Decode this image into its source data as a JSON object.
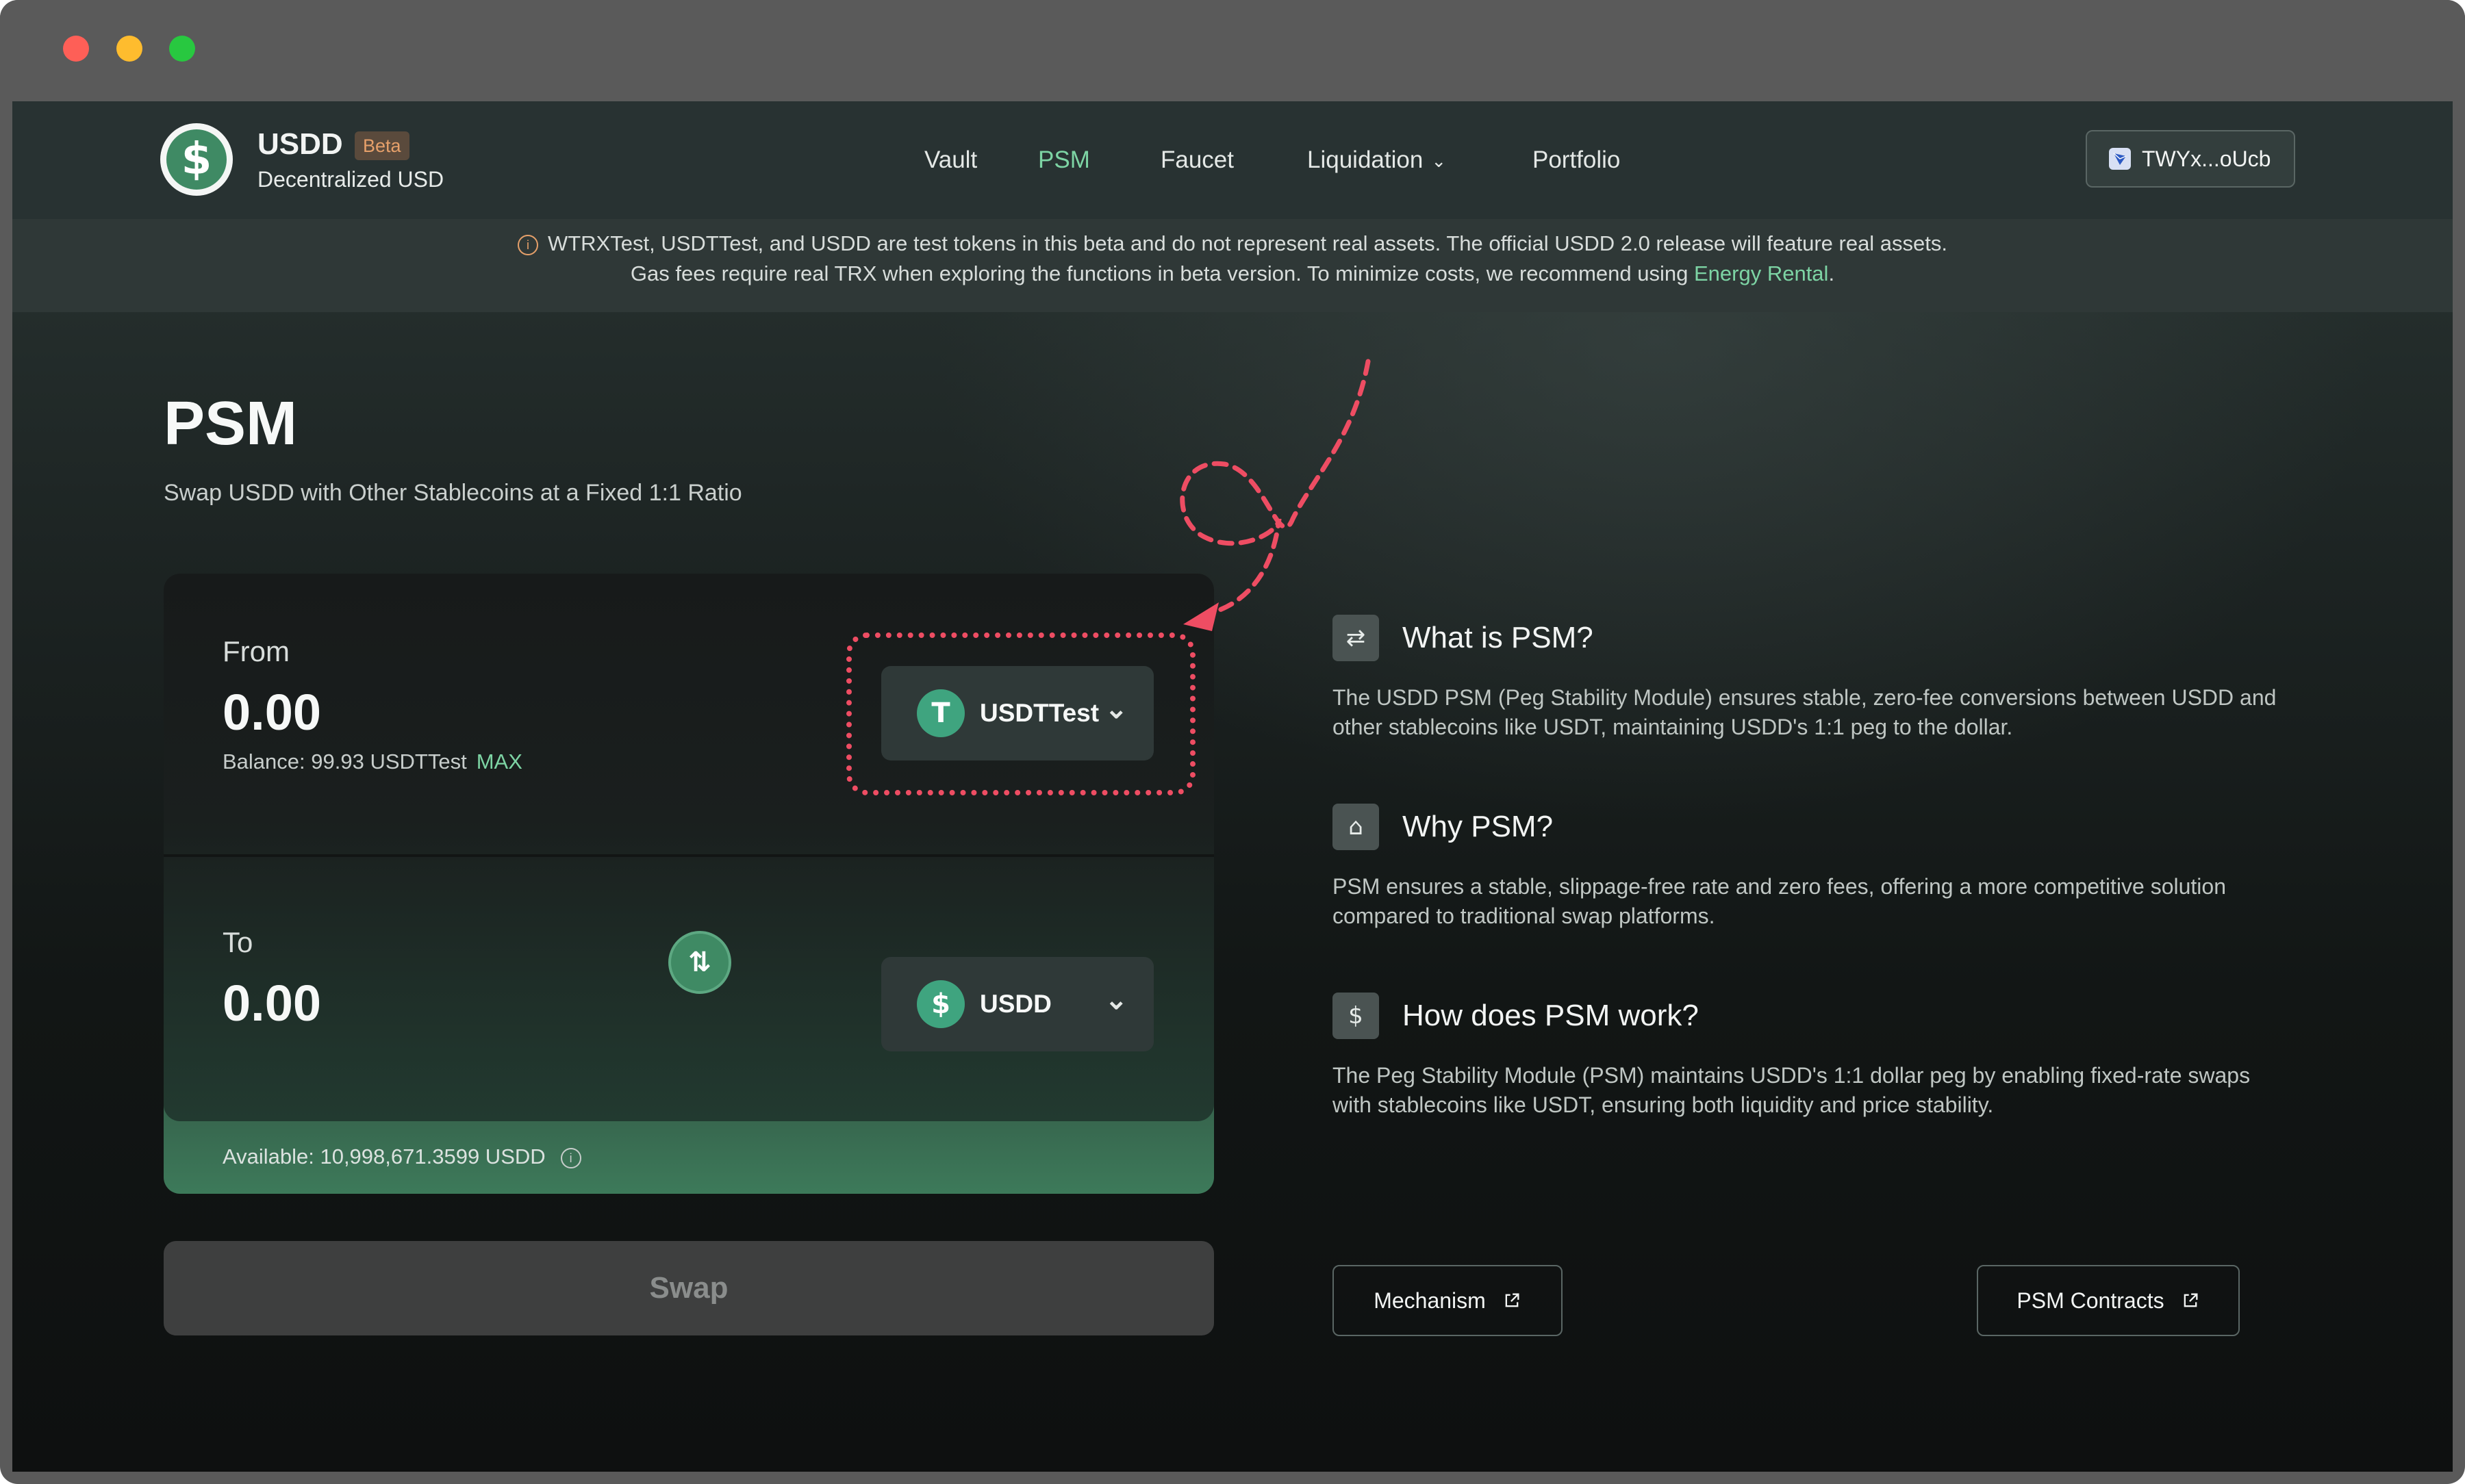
{
  "window": {
    "controls": [
      "close",
      "minimize",
      "zoom"
    ]
  },
  "brand": {
    "name": "USDD",
    "badge": "Beta",
    "tagline": "Decentralized USD",
    "logo_glyph": "$"
  },
  "nav": {
    "items": [
      {
        "label": "Vault",
        "active": false
      },
      {
        "label": "PSM",
        "active": true
      },
      {
        "label": "Faucet",
        "active": false
      },
      {
        "label": "Liquidation",
        "active": false,
        "has_dropdown": true
      },
      {
        "label": "Portfolio",
        "active": false
      }
    ],
    "wallet": {
      "address": "TWYx...oUcb",
      "icon": "wallet-icon"
    }
  },
  "banner": {
    "line1": "WTRXTest, USDTTest, and USDD are test tokens in this beta and do not represent real assets. The official USDD 2.0 release will feature real assets.",
    "line2_prefix": "Gas fees require real TRX when exploring the functions in beta version. To minimize costs, we recommend using",
    "line2_link": "Energy Rental",
    "line2_suffix": "."
  },
  "page": {
    "title": "PSM",
    "subtitle": "Swap USDD with Other Stablecoins at a Fixed 1:1 Ratio"
  },
  "swap": {
    "from": {
      "label": "From",
      "amount": "0.00",
      "balance": "Balance: 99.93 USDTTest",
      "max": "MAX",
      "token": "USDTTest",
      "token_glyph": "T"
    },
    "to": {
      "label": "To",
      "amount": "0.00",
      "token": "USDD",
      "token_glyph": "$"
    },
    "available": "Available:  10,998,671.3599 USDD",
    "button": "Swap"
  },
  "info": [
    {
      "title": "What is PSM?",
      "icon": "exchange-icon",
      "text": "The USDD PSM (Peg Stability Module) ensures stable, zero-fee conversions between USDD and other stablecoins like USDT, maintaining USDD's 1:1 peg to the dollar."
    },
    {
      "title": "Why PSM?",
      "icon": "bank-icon",
      "text": "PSM ensures a stable, slippage-free rate and zero fees, offering a more competitive solution compared to traditional swap platforms."
    },
    {
      "title": "How does PSM work?",
      "icon": "coin-cycle-icon",
      "text": "The Peg Stability Module (PSM) maintains USDD's 1:1 dollar peg by enabling fixed-rate swaps with stablecoins like USDT, ensuring both liquidity and price stability."
    }
  ],
  "links": {
    "mechanism": "Mechanism",
    "contracts": "PSM Contracts"
  },
  "colors": {
    "accent": "#7dd4a4",
    "brand_green": "#3f8a64",
    "warning": "#e6a06a",
    "annotation": "#ee4d63"
  }
}
